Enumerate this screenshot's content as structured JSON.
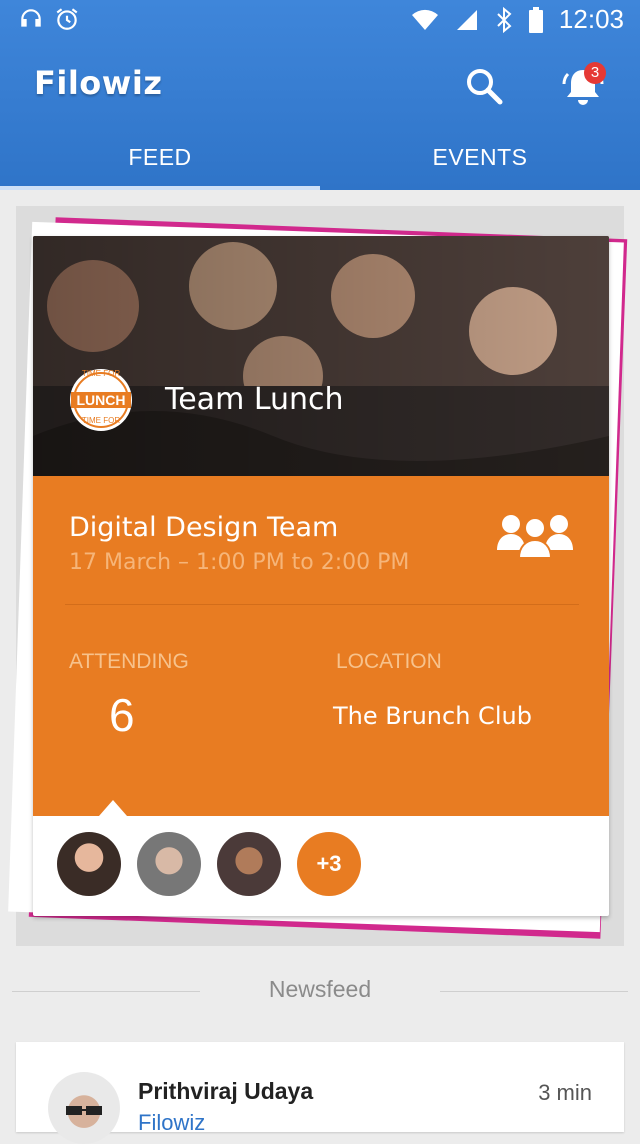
{
  "status_bar": {
    "time": "12:03",
    "icons": [
      "headphones-icon",
      "alarm-icon",
      "wifi-icon",
      "signal-icon",
      "bluetooth-icon",
      "battery-icon"
    ]
  },
  "header": {
    "app_name": "Filowiz",
    "notification_count": "3",
    "tabs": [
      {
        "label": "FEED",
        "selected": true
      },
      {
        "label": "EVENTS",
        "selected": false
      }
    ]
  },
  "event_card": {
    "logo_top": "TIME FOR",
    "logo_main": "LUNCH",
    "logo_bottom": "TIME FOR",
    "title": "Team Lunch",
    "team": "Digital Design Team",
    "date_time": "17 March  –  1:00 PM to 2:00 PM",
    "attending_label": "ATTENDING",
    "attending_count": "6",
    "location_label": "LOCATION",
    "location_value": "The Brunch Club",
    "more_attendees": "+3",
    "colors": {
      "accent": "#e87c22",
      "pink": "#d1298d",
      "header": "#2f74c8"
    }
  },
  "newsfeed": {
    "title": "Newsfeed",
    "posts": [
      {
        "author": "Prithviraj Udaya",
        "time": "3 min",
        "subtitle": "Filowiz"
      }
    ]
  }
}
